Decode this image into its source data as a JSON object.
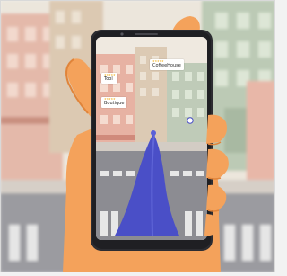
{
  "scene": {
    "description_alt": "Hand holding a smartphone showing an augmented reality street navigation view",
    "colors": {
      "sky": "#e8e2d8",
      "building_pink": "#e7b3a6",
      "building_tan": "#dcc8b0",
      "building_green": "#b9c8b2",
      "road": "#8f8f93",
      "hand": "#f4a25b",
      "hand_shadow": "#e0843a",
      "phone": "#2c2c31",
      "ar_arrow": "#4a4fc7"
    }
  },
  "phone": {
    "places": [
      {
        "name": "CoffeeHouse",
        "stars_text": "★★★★★",
        "sub": ""
      },
      {
        "name": "Tool",
        "stars_text": "★★★★★",
        "sub": ""
      },
      {
        "name": "Boutique",
        "stars_text": "★★★★★",
        "sub": ""
      }
    ]
  }
}
